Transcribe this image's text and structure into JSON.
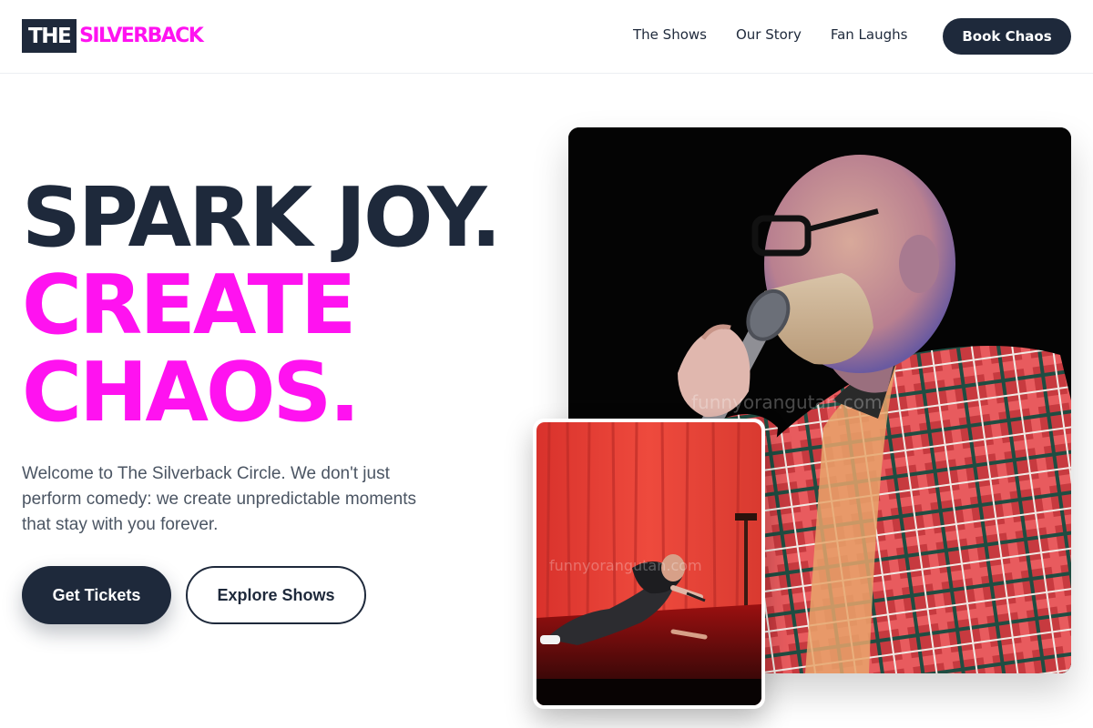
{
  "brand": {
    "logo_dark": "THE",
    "logo_accent": "SILVERBACK"
  },
  "nav": {
    "items": [
      {
        "label": "The Shows"
      },
      {
        "label": "Our Story"
      },
      {
        "label": "Fan Laughs"
      }
    ],
    "cta_label": "Book Chaos"
  },
  "hero": {
    "line1": "SPARK JOY.",
    "line2": "CREATE",
    "line3": "CHAOS.",
    "intro": "Welcome to The Silverback Circle. We don't just perform comedy: we create unpredictable moments that stay with you forever.",
    "primary_cta": "Get Tickets",
    "secondary_cta": "Explore Shows"
  },
  "images": {
    "main_watermark": "funnyorangutan.com",
    "inset_watermark": "funnyorangutan.com"
  },
  "colors": {
    "accent": "#ff12f0",
    "dark": "#1e293b",
    "body_text": "#4b5563"
  }
}
